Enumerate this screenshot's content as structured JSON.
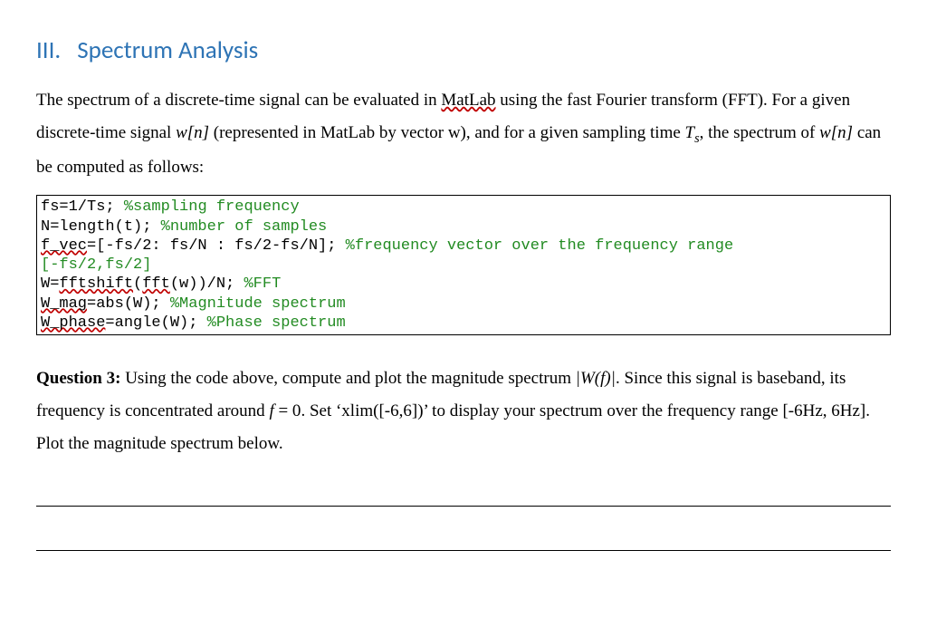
{
  "heading": {
    "number": "III.",
    "title": "Spectrum Analysis"
  },
  "intro": {
    "part1": "The spectrum of a discrete-time signal can be evaluated in ",
    "matlab": "MatLab",
    "part2": " using the fast Fourier transform (FFT). For a given discrete-time signal ",
    "wn": "w[n]",
    "part3": " (represented in MatLab by vector w), and for a given sampling time ",
    "Ts_T": "T",
    "Ts_s": "s",
    "part4": ", the spectrum of ",
    "wn2": "w[n]",
    "part5": " can be computed as follows:"
  },
  "code": {
    "l1a": "fs=1/Ts; ",
    "l1b": "%sampling frequency",
    "l2a": "N=length(t); ",
    "l2b": "%number of samples",
    "l3a_sq": "f_vec",
    "l3a_rest": "=[-fs/2: fs/N : fs/2-fs/N]; ",
    "l3b": "%frequency vector over the frequency range",
    "l4": "[-fs/2,fs/2]",
    "l5a": "W=",
    "l5a_sq1": "fftshift",
    "l5a_mid": "(",
    "l5a_sq2": "fft",
    "l5a_rest": "(w))/N; ",
    "l5b": "%FFT",
    "l6a_sq": "W_mag",
    "l6a_rest": "=abs(W); ",
    "l6b": "%Magnitude spectrum",
    "l7a_sq": "W_phase",
    "l7a_rest": "=angle(W); ",
    "l7b": "%Phase spectrum"
  },
  "question": {
    "label": "Question 3:",
    "part1": " Using the code above, compute and plot the magnitude spectrum ",
    "mag": "|W(f)|",
    "part2": ". Since this signal is baseband, its frequency is concentrated around ",
    "f": "f",
    "eq0": " = 0",
    "part3": ". Set ‘xlim([-6,6])’ to display your spectrum over the frequency range [-6Hz, 6Hz]. Plot the magnitude spectrum below."
  }
}
